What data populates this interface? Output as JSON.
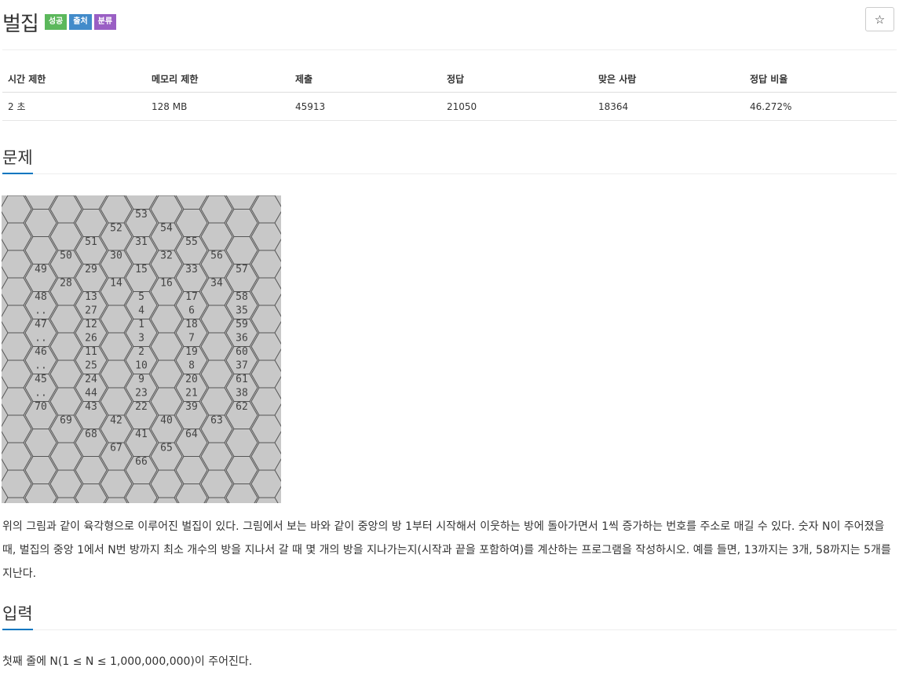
{
  "problem": {
    "title": "벌집",
    "badges": [
      {
        "label": "성공",
        "color": "#5cb85c"
      },
      {
        "label": "출처",
        "color": "#428bca"
      },
      {
        "label": "분류",
        "color": "#9a5fc4"
      }
    ],
    "star_icon": "☆"
  },
  "info_table": {
    "headers": [
      "시간 제한",
      "메모리 제한",
      "제출",
      "정답",
      "맞은 사람",
      "정답 비율"
    ],
    "values": [
      "2 초",
      "128 MB",
      "45913",
      "21050",
      "18364",
      "46.272%"
    ]
  },
  "sections": {
    "problem_title": "문제",
    "input_title": "입력"
  },
  "figure": {
    "row_labels": [
      [
        "53"
      ],
      [
        "52",
        "54"
      ],
      [
        "51",
        "31",
        "55"
      ],
      [
        "50",
        "30",
        "32",
        "56"
      ],
      [
        "49",
        "29",
        "15",
        "33",
        "57"
      ],
      [
        "28",
        "14",
        "16",
        "34"
      ],
      [
        "48",
        "13",
        "5",
        "17",
        "58"
      ],
      [
        "..",
        "27",
        "4",
        "6",
        "35"
      ],
      [
        "47",
        "12",
        "1",
        "18",
        "59"
      ],
      [
        "..",
        "26",
        "3",
        "7",
        "36"
      ],
      [
        "46",
        "11",
        "2",
        "19",
        "60"
      ],
      [
        "..",
        "25",
        "10",
        "8",
        "37"
      ],
      [
        "45",
        "24",
        "9",
        "20",
        "61"
      ],
      [
        "..",
        "44",
        "23",
        "21",
        "38"
      ],
      [
        "70",
        "43",
        "22",
        "39",
        "62"
      ],
      [
        "69",
        "42",
        "40",
        "63"
      ],
      [
        "68",
        "41",
        "64"
      ],
      [
        "67",
        "65"
      ],
      [
        "66"
      ]
    ]
  },
  "description": "위의 그림과 같이 육각형으로 이루어진 벌집이 있다. 그림에서 보는 바와 같이 중앙의 방 1부터 시작해서 이웃하는 방에 돌아가면서 1씩 증가하는 번호를 주소로 매길 수 있다. 숫자 N이 주어졌을 때, 벌집의 중앙 1에서 N번 방까지 최소 개수의 방을 지나서 갈 때 몇 개의 방을 지나가는지(시작과 끝을 포함하여)를 계산하는 프로그램을 작성하시오. 예를 들면, 13까지는 3개, 58까지는 5개를 지난다.",
  "input_description": "첫째 줄에 N(1 ≤ N ≤ 1,000,000,000)이 주어진다."
}
